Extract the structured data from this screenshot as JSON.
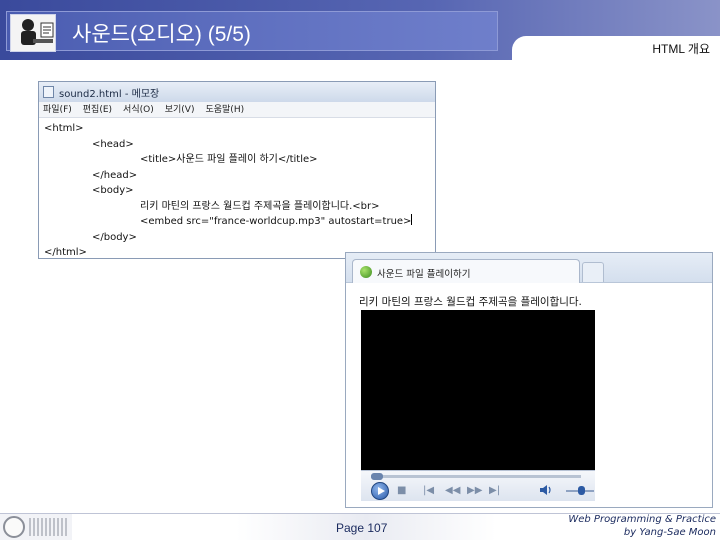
{
  "slide": {
    "title": "사운드(오디오) (5/5)",
    "subtitle": "HTML 개요",
    "page_number": "Page 107",
    "footer_line1": "Web Programming & Practice",
    "footer_line2": "by Yang-Sae Moon"
  },
  "notepad": {
    "window_title": "sound2.html - 메모장",
    "menu": [
      "파일(F)",
      "편집(E)",
      "서식(O)",
      "보기(V)",
      "도움말(H)"
    ],
    "lines": [
      "<html>",
      "<head>",
      "<title>사운드 파일 플레이 하기</title>",
      "</head>",
      "<body>",
      "리키 마틴의 프랑스 월드컵 주제곡을 플레이합니다.<br>",
      "<embed src=\"france-worldcup.mp3\" autostart=true>",
      "</body>",
      "</html>"
    ]
  },
  "browser": {
    "tab_title": "사운드 파일 플레이하기",
    "page_text": "리키 마틴의 프랑스 월드컵 주제곡을 플레이합니다."
  },
  "player": {
    "buttons": [
      "play-icon",
      "stop-icon",
      "previous-icon",
      "rewind-icon",
      "fast-forward-icon",
      "next-icon",
      "volume-icon"
    ],
    "seek_progress": 0.0,
    "volume_level": 0.5
  }
}
